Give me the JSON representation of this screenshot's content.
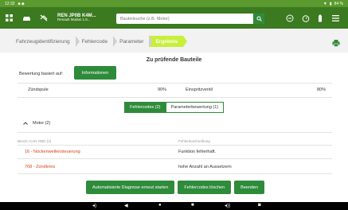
{
  "status": {
    "time": "12:32",
    "battery": "84 %"
  },
  "vehicle": {
    "name": "REN JP0B K4M...",
    "model": "Renault Modus 1.6..."
  },
  "search": {
    "placeholder": "Bauteilsuche (z.B. Motor)"
  },
  "breadcrumb": [
    "Fahrzeugidentifizierung",
    "Fehlercode",
    "Parameter",
    "Ergebnis"
  ],
  "main": {
    "title": "Zu prüfende Bauteile",
    "basis_label": "Bewertung basiert auf:",
    "info_button": "Informationen",
    "components": [
      {
        "name": "Zündspule",
        "percent": "90%"
      },
      {
        "name": "Einspritzventil",
        "percent": "80%"
      }
    ],
    "tabs": [
      "Fehlercodes (2)",
      "Parameterbewertung (1)"
    ],
    "group": "Motor (2)",
    "table": {
      "col1": "Benzin CAN OBD (2)",
      "col2": "Fehlerbeschreibung",
      "rows": [
        {
          "code": "16 - Nockenwellensteuerung",
          "desc": "Funktion fehlerhaft."
        },
        {
          "code": "768 - Zündkreis",
          "desc": "hohe Anzahl an Aussetzern"
        }
      ]
    },
    "actions": [
      "Automatisierte Diagnose erneut starten",
      "Fehlercodes löschen",
      "Beenden"
    ]
  },
  "colors": {
    "appbar": "#3b7a1f",
    "button": "#2e8b3a",
    "active_crumb": "#c8ef3a",
    "error_code": "#d9421b"
  }
}
